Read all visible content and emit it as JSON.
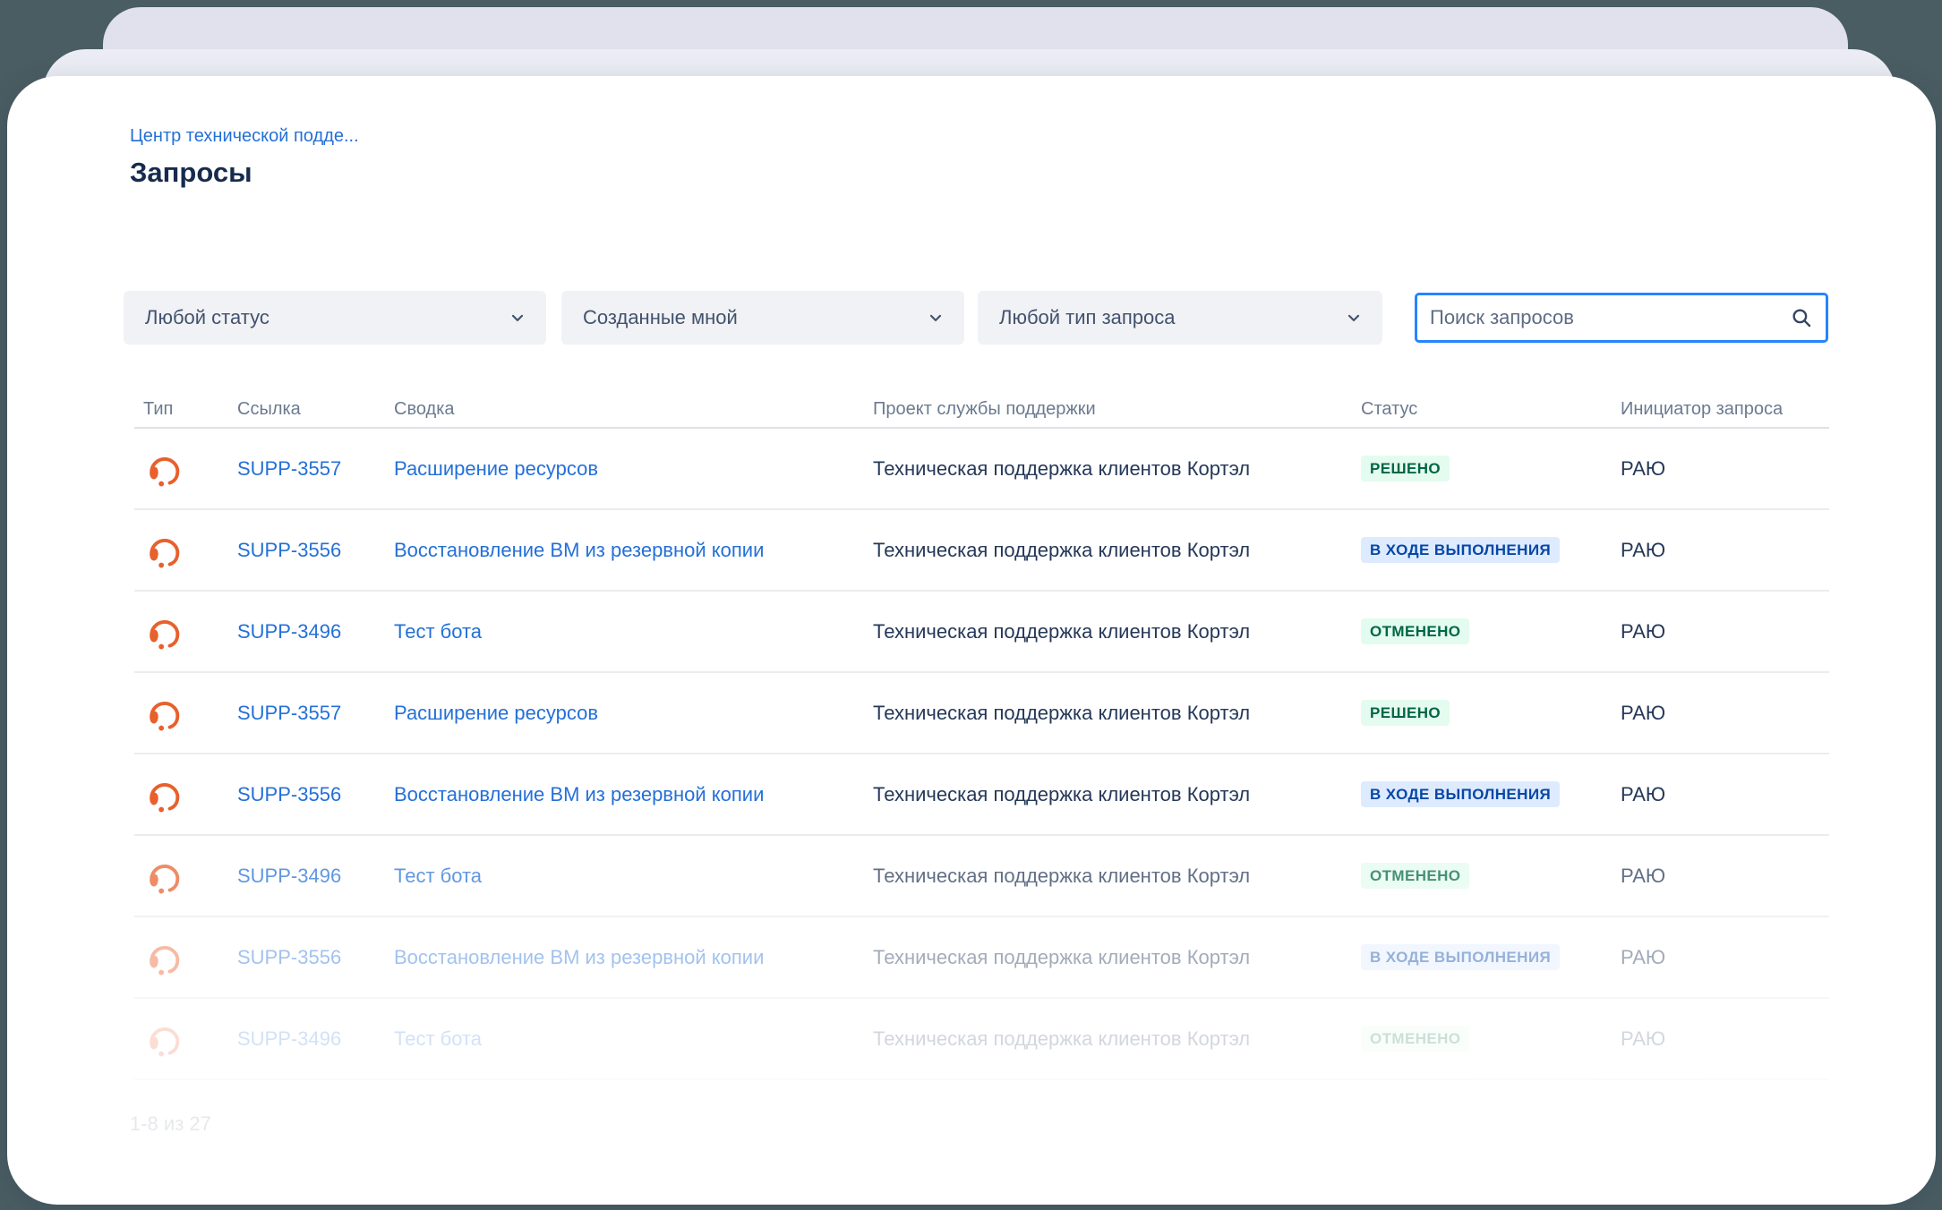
{
  "window": {
    "breadcrumb": "Центр технической подде...",
    "title": "Запросы",
    "pagination": "1-8 из 27"
  },
  "filters": {
    "status_filter": {
      "value": "Любой статус"
    },
    "owner_filter": {
      "value": "Созданные мной"
    },
    "type_filter": {
      "value": "Любой тип запроса"
    },
    "search": {
      "placeholder": "Поиск запросов"
    }
  },
  "table": {
    "columns": [
      "Тип",
      "Ссылка",
      "Сводка",
      "Проект службы поддержки",
      "Статус",
      "Инициатор запроса"
    ],
    "rows": [
      {
        "type_icon": "headset-icon",
        "reference": "SUPP-3557",
        "summary": "Расширение ресурсов",
        "project": "Техническая поддержка клиентов Кортэл",
        "status": "РЕШЕНО",
        "status_kind": "success",
        "reporter": "РАЮ",
        "fade": 1
      },
      {
        "type_icon": "headset-icon",
        "reference": "SUPP-3556",
        "summary": "Восстановление ВМ из резервной копии",
        "project": "Техническая поддержка клиентов Кортэл",
        "status": "В ХОДЕ ВЫПОЛНЕНИЯ",
        "status_kind": "info",
        "reporter": "РАЮ",
        "fade": 1
      },
      {
        "type_icon": "headset-icon",
        "reference": "SUPP-3496",
        "summary": "Тест бота",
        "project": "Техническая поддержка клиентов Кортэл",
        "status": "ОТМЕНЕНО",
        "status_kind": "success",
        "reporter": "РАЮ",
        "fade": 1
      },
      {
        "type_icon": "headset-icon",
        "reference": "SUPP-3557",
        "summary": "Расширение ресурсов",
        "project": "Техническая поддержка клиентов Кортэл",
        "status": "РЕШЕНО",
        "status_kind": "success",
        "reporter": "РАЮ",
        "fade": 1
      },
      {
        "type_icon": "headset-icon",
        "reference": "SUPP-3556",
        "summary": "Восстановление ВМ из резервной копии",
        "project": "Техническая поддержка клиентов Кортэл",
        "status": "В ХОДЕ ВЫПОЛНЕНИЯ",
        "status_kind": "info",
        "reporter": "РАЮ",
        "fade": 1
      },
      {
        "type_icon": "headset-icon",
        "reference": "SUPP-3496",
        "summary": "Тест бота",
        "project": "Техническая поддержка клиентов Кортэл",
        "status": "ОТМЕНЕНО",
        "status_kind": "success",
        "reporter": "РАЮ",
        "fade": 0.72
      },
      {
        "type_icon": "headset-icon",
        "reference": "SUPP-3556",
        "summary": "Восстановление ВМ из резервной копии",
        "project": "Техническая поддержка клиентов Кортэл",
        "status": "В ХОДЕ ВЫПОЛНЕНИЯ",
        "status_kind": "info",
        "reporter": "РАЮ",
        "fade": 0.42
      },
      {
        "type_icon": "headset-icon",
        "reference": "SUPP-3496",
        "summary": "Тест бота",
        "project": "Техническая поддержка клиентов Кортэл",
        "status": "ОТМЕНЕНО",
        "status_kind": "success",
        "reporter": "РАЮ",
        "fade": 0.2
      }
    ]
  },
  "colors": {
    "page_background": "#4A5D62",
    "card_back": "#E0E1EC",
    "card_mid": "#ECEDF4",
    "card_front": "#FFFFFF",
    "link": "#2470D8",
    "accent_orange": "#E8602C",
    "search_border": "#2684FF",
    "status_success_bg": "#E3FCEF",
    "status_success_fg": "#006644",
    "status_info_bg": "#DEEBFF",
    "status_info_fg": "#0747A6"
  }
}
